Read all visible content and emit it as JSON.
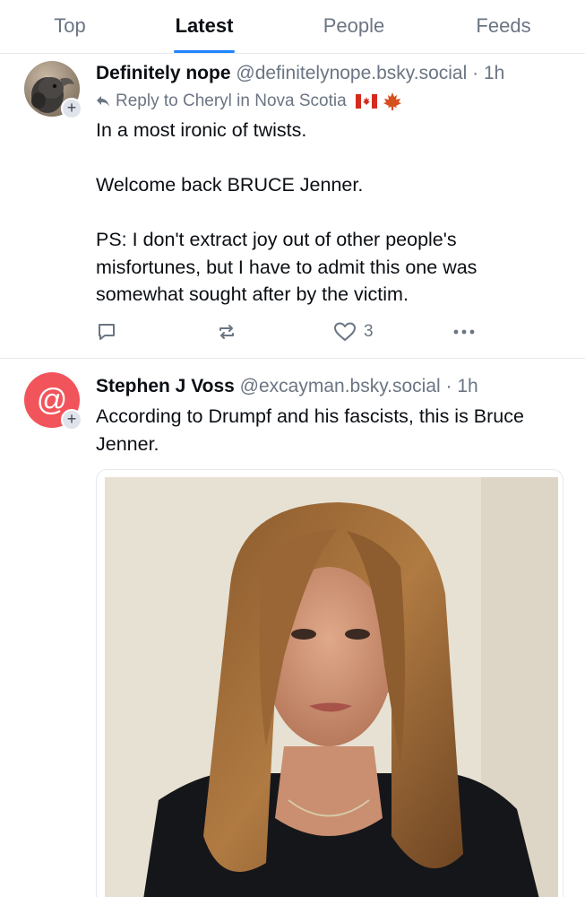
{
  "tabs": [
    "Top",
    "Latest",
    "People",
    "Feeds"
  ],
  "active_tab": "Latest",
  "colors": {
    "accent": "#1f85ff",
    "muted": "#6b7583",
    "text": "#0b0f14",
    "avatar2_bg": "#f2545b"
  },
  "posts": [
    {
      "display_name": "Definitely nope",
      "handle": "@definitelynope.bsky.social",
      "separator": "·",
      "time": "1h",
      "reply_to": "Reply to Cheryl in Nova Scotia",
      "paragraphs": [
        "In a most ironic of twists.",
        "Welcome back BRUCE Jenner.",
        "PS: I don't extract joy out of other people's misfortunes, but I have to admit this one was somewhat sought after by the victim."
      ],
      "like_count": "3",
      "icons": [
        "reply-icon",
        "repost-icon",
        "like-icon",
        "more-icon"
      ]
    },
    {
      "display_name": "Stephen J Voss",
      "handle": "@excayman.bsky.social",
      "separator": "·",
      "time": "1h",
      "paragraphs": [
        "According to Drumpf and his fascists, this is Bruce Jenner."
      ],
      "avatar_glyph": "@",
      "image_alt": "photo"
    }
  ],
  "follow_glyph": "+"
}
